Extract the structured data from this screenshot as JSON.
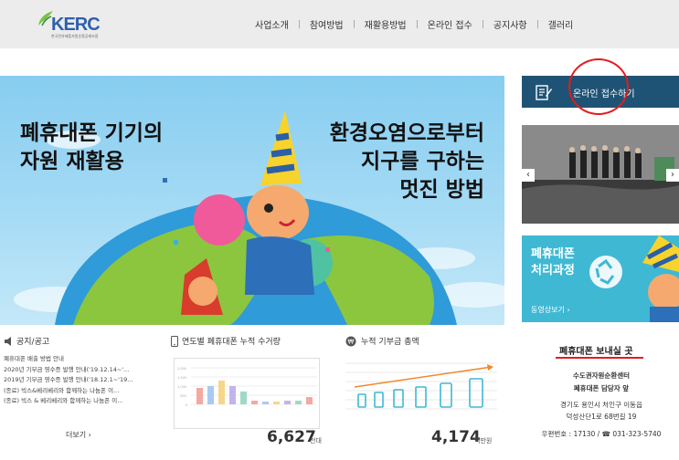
{
  "header": {
    "logo_text": "KERC",
    "logo_sub": "한국전자제품자원순환공제조합",
    "nav": [
      "사업소개",
      "참여방법",
      "재활용방법",
      "온라인 접수",
      "공지사항",
      "갤러리"
    ]
  },
  "hero": {
    "left_lines": [
      "폐휴대폰 기기의",
      "자원 재활용"
    ],
    "right_lines": [
      "환경오염으로부터",
      "지구를 구하는",
      "멋진 방법"
    ]
  },
  "side": {
    "cta_label": "온라인 접수하기",
    "cta_icon": "document-pen-icon",
    "slider_prev": "‹",
    "slider_next": "›",
    "process_title_lines": [
      "폐휴대폰",
      "처리과정"
    ],
    "process_link": "동영상보기 ›"
  },
  "notices": {
    "title": "공지/공고",
    "items": [
      "폐휴대폰 배출 방법 안내",
      "2020년 기부금 영수증 발행 안내('19.12.14~'...",
      "2019년 기부금 영수증 발행 안내('18.12.1~'19...",
      "(종료) 빅스&베리베리와 함께하는 나눔폰 이...",
      "(종료) 빅스 & 베리베리와 함께하는 나눔폰 이..."
    ],
    "more": "더보기 ›"
  },
  "yearly": {
    "title": "연도별 폐휴대폰 누적 수거량",
    "total": "6,627",
    "unit": "천대"
  },
  "donation": {
    "title": "누적 기부금 총액",
    "total": "4,174",
    "unit": "백만원"
  },
  "send": {
    "title": "폐휴대폰 보내실 곳",
    "lines": [
      "수도권자원순환센터",
      "폐휴대폰 담당자 앞",
      "경기도 용인시 처인구 이동읍",
      "덕성산단1로 68번길 19",
      "우편번호 : 17130 / ☎ 031-323-5740"
    ]
  },
  "colors": {
    "accent": "#1f5375",
    "highlight_red": "#e31b1b",
    "hero_sky": "#87cdf0",
    "process_bg": "#3fb8d4"
  }
}
